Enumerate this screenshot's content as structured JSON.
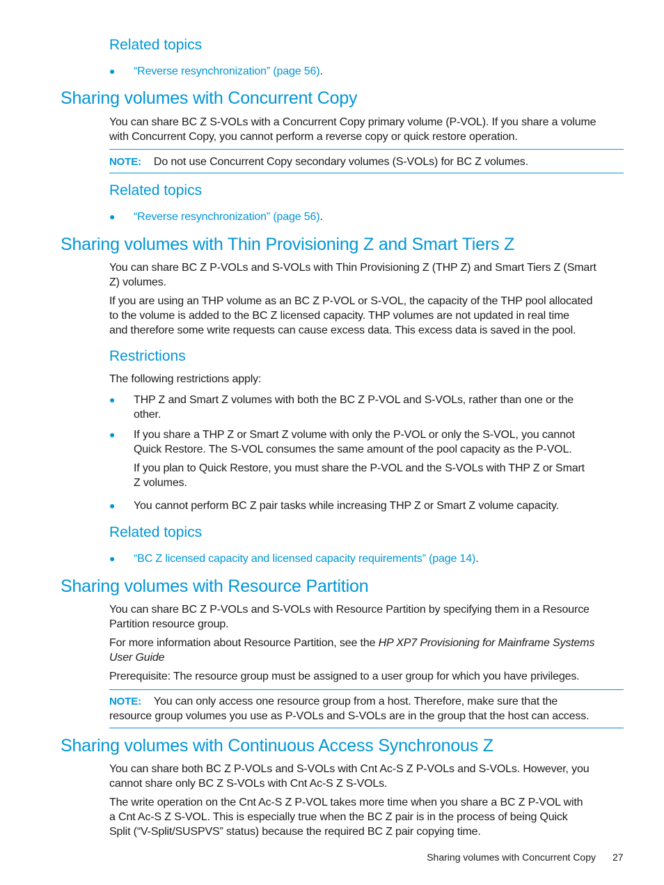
{
  "sections": {
    "related1": {
      "heading": "Related topics",
      "link": "“Reverse resynchronization” (page 56)",
      "suffix": "."
    },
    "concurrent_copy": {
      "title": "Sharing volumes with Concurrent Copy",
      "para1_line1": "You can share BC Z S-VOLs with a Concurrent Copy primary volume (P-VOL). If you share a volume",
      "para1_line2": "with Concurrent Copy, you cannot perform a reverse copy or quick restore operation.",
      "note_label": "NOTE:",
      "note_text": "Do not use Concurrent Copy secondary volumes (S-VOLs) for BC Z volumes.",
      "related_heading": "Related topics",
      "related_link": "“Reverse resynchronization” (page 56)",
      "related_suffix": "."
    },
    "thin_provisioning": {
      "title": "Sharing volumes with Thin Provisioning Z and Smart Tiers Z",
      "para1_line1": "You can share BC Z P-VOLs and S-VOLs with Thin Provisioning Z (THP Z) and Smart Tiers Z (Smart",
      "para1_line2": "Z) volumes.",
      "para2_line1": "If you are using an THP volume as an BC Z P-VOL or S-VOL, the capacity of the THP pool allocated",
      "para2_line2": "to the volume is added to the BC Z licensed capacity. THP volumes are not updated in real time",
      "para2_line3": "and therefore some write requests can cause excess data. This excess data is saved in the pool.",
      "restrictions_heading": "Restrictions",
      "restrictions_intro": "The following restrictions apply:",
      "bullets": [
        {
          "line1": "THP Z and Smart Z volumes with both the BC Z P-VOL and S-VOLs, rather than one or the",
          "line2": "other."
        },
        {
          "line1": "If you share a THP Z or Smart Z volume with only the P-VOL or only the S-VOL, you cannot",
          "line2": "Quick Restore. The S-VOL consumes the same amount of the pool capacity as the P-VOL.",
          "sub_line1": "If you plan to Quick Restore, you must share the P-VOL and the S-VOLs with THP Z or Smart",
          "sub_line2": "Z volumes."
        },
        {
          "line1": "You cannot perform BC Z pair tasks while increasing THP Z or Smart Z volume capacity."
        }
      ],
      "related_heading": "Related topics",
      "related_link": "“BC Z licensed capacity and licensed capacity requirements” (page 14)",
      "related_suffix": "."
    },
    "resource_partition": {
      "title": "Sharing volumes with Resource Partition",
      "para1_line1": "You can share BC Z P-VOLs and S-VOLs with Resource Partition by specifying them in a Resource",
      "para1_line2": "Partition resource group.",
      "para2_prefix": "For more information about Resource Partition, see the ",
      "para2_italic1": "HP XP7 Provisioning for Mainframe Systems",
      "para2_italic2": "User Guide",
      "para3": "Prerequisite: The resource group must be assigned to a user group for which you have privileges.",
      "note_label": "NOTE:",
      "note_line1": "You can only access one resource group from a host. Therefore, make sure that the",
      "note_line2": "resource group volumes you use as P-VOLs and S-VOLs are in the group that the host can access."
    },
    "continuous_access": {
      "title": "Sharing volumes with Continuous Access Synchronous Z",
      "para1_line1": "You can share both BC Z P-VOLs and S-VOLs with Cnt Ac-S Z P-VOLs and S-VOLs. However, you",
      "para1_line2": "cannot share only BC Z S-VOLs with Cnt Ac-S Z S-VOLs.",
      "para2_line1": "The write operation on the Cnt Ac-S Z P-VOL takes more time when you share a BC Z P-VOL with",
      "para2_line2": "a Cnt Ac-S Z S-VOL. This is especially true when the BC Z pair is in the process of being Quick",
      "para2_line3": "Split (“V-Split/SUSPVS” status) because the required BC Z pair copying time."
    }
  },
  "footer": {
    "section_title": "Sharing volumes with Concurrent Copy",
    "page_number": "27"
  },
  "colors": {
    "accent": "#0096d6",
    "text": "#1a1a1a"
  }
}
